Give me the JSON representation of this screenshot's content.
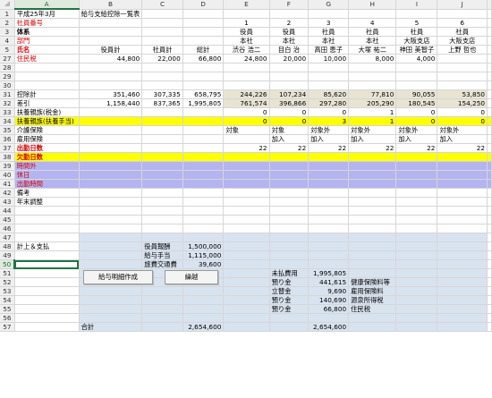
{
  "columns": [
    "A",
    "B",
    "C",
    "D",
    "E",
    "F",
    "G",
    "H",
    "I",
    "J"
  ],
  "rows": {
    "r1": {
      "num": "1",
      "a": "平成25年3月",
      "b": "給与支給控除一覧表"
    },
    "r2": {
      "num": "2",
      "a": "社員番号",
      "e": "1",
      "f": "2",
      "g": "3",
      "h": "4",
      "i": "5",
      "j": "6"
    },
    "r3": {
      "num": "3",
      "a": "体系",
      "e": "役員",
      "f": "役員",
      "g": "社員",
      "h": "社員",
      "i": "社員",
      "j": "社員"
    },
    "r4": {
      "num": "4",
      "a": "部門",
      "e": "本社",
      "f": "本社",
      "g": "本社",
      "h": "本社",
      "i": "大阪支店",
      "j": "大阪支店"
    },
    "r5": {
      "num": "5",
      "a": "氏名",
      "b": "役員計",
      "c": "社員計",
      "d": "総計",
      "e": "渋谷 浩二",
      "f": "目白 治",
      "g": "高田 恵子",
      "h": "大塚 祐二",
      "i": "神田 美智子",
      "j": "上野 哲也"
    },
    "r27": {
      "num": "27",
      "a": "住民税",
      "b": "44,800",
      "c": "22,000",
      "d": "66,800",
      "e": "24,800",
      "f": "20,000",
      "g": "10,000",
      "h": "8,000",
      "i": "4,000",
      "j": ""
    },
    "r28": {
      "num": "28"
    },
    "r29": {
      "num": "29"
    },
    "r30": {
      "num": "30"
    },
    "r31": {
      "num": "31",
      "a": "控除計",
      "b": "351,460",
      "c": "307,335",
      "d": "658,795",
      "e": "244,226",
      "f": "107,234",
      "g": "85,620",
      "h": "77,810",
      "i": "90,055",
      "j": "53,850"
    },
    "r32": {
      "num": "32",
      "a": "差引",
      "b": "1,158,440",
      "c": "837,365",
      "d": "1,995,805",
      "e": "761,574",
      "f": "396,866",
      "g": "297,280",
      "h": "205,290",
      "i": "180,545",
      "j": "154,250"
    },
    "r33": {
      "num": "33",
      "a": "扶養親族(税金)",
      "e": "0",
      "f": "0",
      "g": "0",
      "h": "1",
      "i": "0",
      "j": "0"
    },
    "r34": {
      "num": "34",
      "a": "扶養親族(扶養手当)",
      "e": "0",
      "f": "0",
      "g": "3",
      "h": "1",
      "i": "0",
      "j": "0"
    },
    "r35": {
      "num": "35",
      "a": "介護保険",
      "e": "対象",
      "f": "対象",
      "g": "対象外",
      "h": "対象外",
      "i": "対象外",
      "j": "対象外"
    },
    "r36": {
      "num": "36",
      "a": "雇用保険",
      "e": "",
      "f": "加入",
      "g": "加入",
      "h": "加入",
      "i": "加入",
      "j": "加入"
    },
    "r37": {
      "num": "37",
      "a": "出勤日数",
      "e": "22",
      "f": "22",
      "g": "22",
      "h": "22",
      "i": "22",
      "j": "22"
    },
    "r38": {
      "num": "38",
      "a": "欠勤日数"
    },
    "r39": {
      "num": "39",
      "a": "時間外"
    },
    "r40": {
      "num": "40",
      "a": "休日"
    },
    "r41": {
      "num": "41",
      "a": "出勤時間"
    },
    "r42": {
      "num": "42",
      "a": "備考"
    },
    "r43": {
      "num": "43",
      "a": "年末調整"
    },
    "r44": {
      "num": "44"
    },
    "r45": {
      "num": "45"
    },
    "r46": {
      "num": "46"
    },
    "r47": {
      "num": "47"
    },
    "r48": {
      "num": "48",
      "a": "計上＆支払",
      "c": "役員報酬",
      "d": "1,500,000"
    },
    "r49": {
      "num": "49",
      "c": "給与手当",
      "d": "1,115,000"
    },
    "r50": {
      "num": "50",
      "c": "旅費交通費",
      "d": "39,600"
    },
    "r51": {
      "num": "51",
      "f": "未払費用",
      "g": "1,995,805"
    },
    "r52": {
      "num": "52",
      "f": "預り金",
      "g": "441,615",
      "h": "健康保険料等"
    },
    "r53": {
      "num": "53",
      "f": "立替金",
      "g": "9,690",
      "h": "雇用保険料"
    },
    "r54": {
      "num": "54",
      "f": "預り金",
      "g": "140,690",
      "h": "源泉所得税"
    },
    "r55": {
      "num": "55",
      "f": "預り金",
      "g": "66,800",
      "h": "住民税"
    },
    "r56": {
      "num": "56"
    },
    "r57": {
      "num": "57",
      "b": "合計",
      "d": "2,654,600",
      "g": "2,654,600"
    }
  },
  "buttons": {
    "detail": "給与明細作成",
    "carryover": "繰越"
  },
  "colors": {
    "yellow": "#ffff00",
    "lavender": "#b4b4f0",
    "red": "#d00000",
    "selection": "#217346"
  }
}
